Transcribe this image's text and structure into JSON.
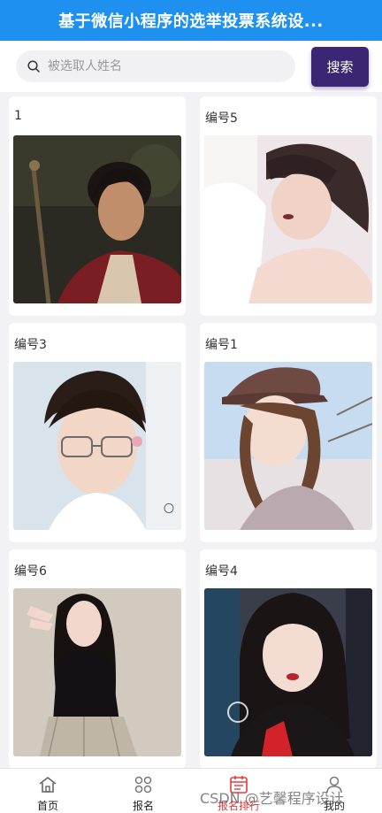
{
  "header": {
    "title": "基于微信小程序的选举投票系统设..."
  },
  "search": {
    "placeholder": "被选取人姓名",
    "button_label": "搜索",
    "icon": "search-icon"
  },
  "candidates": [
    {
      "label": "1"
    },
    {
      "label": "编号5"
    },
    {
      "label": "编号3"
    },
    {
      "label": "编号1"
    },
    {
      "label": "编号6"
    },
    {
      "label": "编号4"
    }
  ],
  "tabbar": {
    "tabs": [
      {
        "label": "首页",
        "icon": "home-icon"
      },
      {
        "label": "报名",
        "icon": "apps-icon"
      },
      {
        "label": "报名排行",
        "icon": "ranking-icon",
        "active": true
      },
      {
        "label": "我的",
        "icon": "profile-icon"
      }
    ]
  },
  "watermark": "CSDN @艺馨程序设计",
  "colors": {
    "header": "#1e90f0",
    "search_button": "#3b2674",
    "active_tab": "#e83a3a"
  }
}
